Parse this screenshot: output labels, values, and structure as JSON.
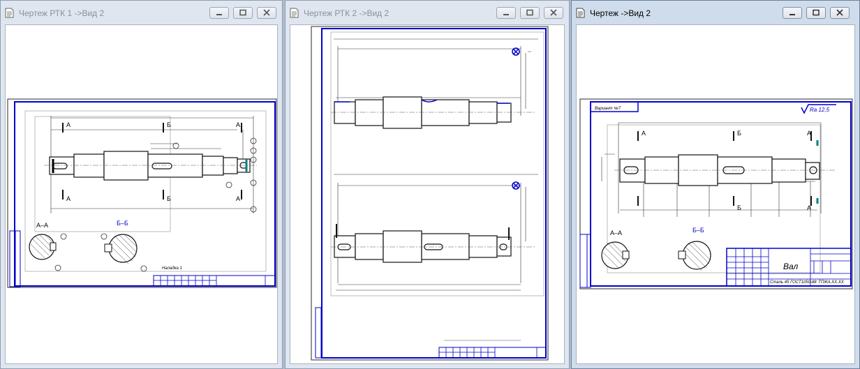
{
  "windows": [
    {
      "title": "Чертеж РТК 1 ->Вид 2",
      "active": false
    },
    {
      "title": "Чертеж РТК 2 ->Вид 2",
      "active": false
    },
    {
      "title": "Чертеж ->Вид 2",
      "active": true
    }
  ],
  "drawing1": {
    "section_aa": "А–А",
    "section_bb": "Б–Б",
    "label_a": "А",
    "label_b": "Б",
    "note": "Наладка 1"
  },
  "drawing3": {
    "section_aa": "А–А",
    "section_bb": "Б–Б",
    "label_a": "А",
    "label_b": "Б",
    "roughness": "Ra 12,5",
    "title_name": "Вал",
    "material": "Сталь 45 ГОСТ1050-88",
    "doc_code": "ТПЖА.ХХ.ХХ",
    "variant": "Вариант №7"
  }
}
